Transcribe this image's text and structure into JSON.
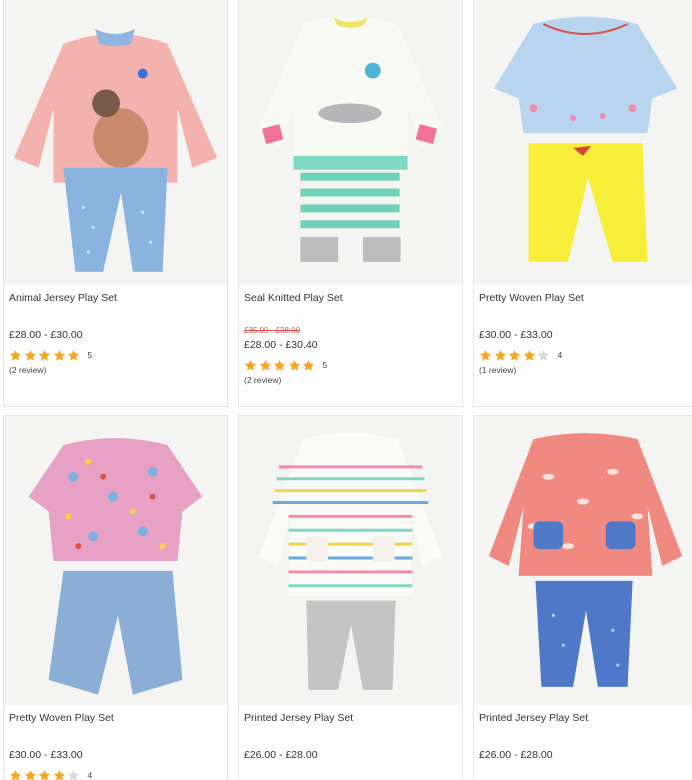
{
  "colors": {
    "star_on": "#f5a623",
    "star_off": "#d9d9d9",
    "sale": "#d9534f"
  },
  "products": [
    {
      "name": "Animal Jersey Play Set",
      "was_price": "",
      "price": "£28.00 - £30.00",
      "rating": 5,
      "rating_count": "5",
      "reviews": "(2 review)"
    },
    {
      "name": "Seal Knitted Play Set",
      "was_price": "£35.00 - £38.00",
      "price": "£28.00 - £30.40",
      "rating": 5,
      "rating_count": "5",
      "reviews": "(2 review)"
    },
    {
      "name": "Pretty Woven Play Set",
      "was_price": "",
      "price": "£30.00 - £33.00",
      "rating": 4,
      "rating_count": "4",
      "reviews": "(1 review)"
    },
    {
      "name": "Pretty Woven Play Set",
      "was_price": "",
      "price": "£30.00 - £33.00",
      "rating": 4,
      "rating_count": "4",
      "reviews": ""
    },
    {
      "name": "Printed Jersey Play Set",
      "was_price": "",
      "price": "£26.00 - £28.00",
      "rating": 0,
      "rating_count": "",
      "reviews": ""
    },
    {
      "name": "Printed Jersey Play Set",
      "was_price": "",
      "price": "£26.00 - £28.00",
      "rating": 0,
      "rating_count": "",
      "reviews": ""
    }
  ]
}
